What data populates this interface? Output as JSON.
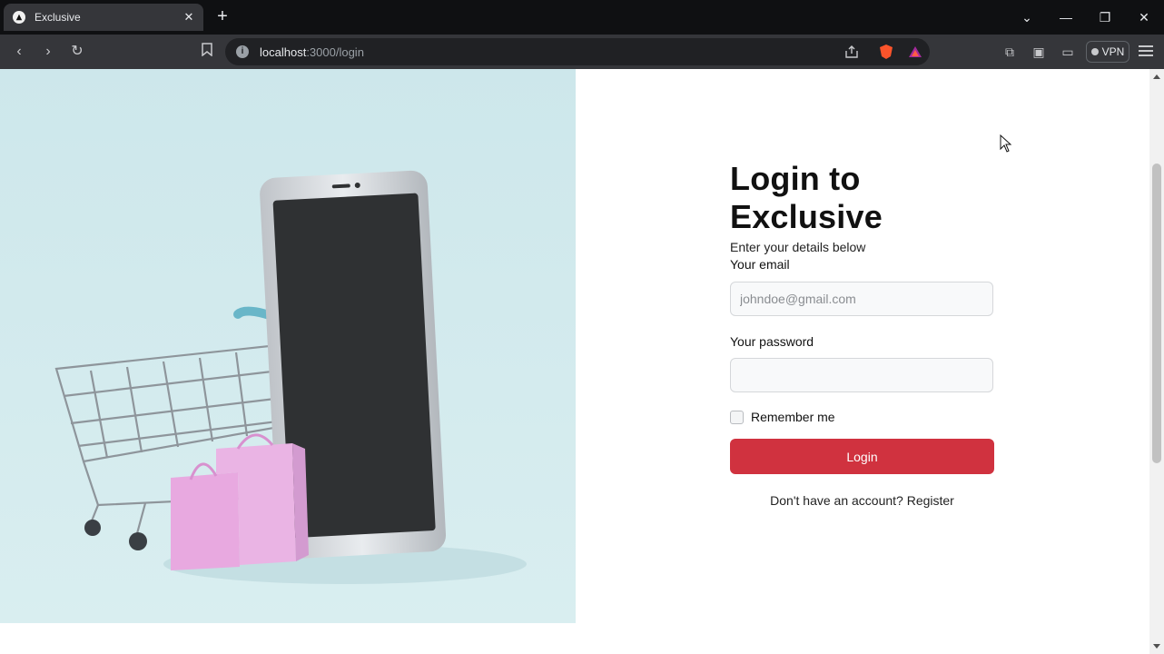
{
  "browser": {
    "tab_title": "Exclusive",
    "url_host": "localhost",
    "url_path": ":3000/login",
    "vpn_label": "VPN"
  },
  "login": {
    "title": "Login to Exclusive",
    "subtitle": "Enter your details below",
    "email_label": "Your email",
    "email_placeholder": "johndoe@gmail.com",
    "password_label": "Your password",
    "remember_label": "Remember me",
    "login_button": "Login",
    "register_prompt": "Don't have an account? Register"
  },
  "colors": {
    "accent": "#d0323f",
    "hero_bg": "#cfe8ec"
  }
}
